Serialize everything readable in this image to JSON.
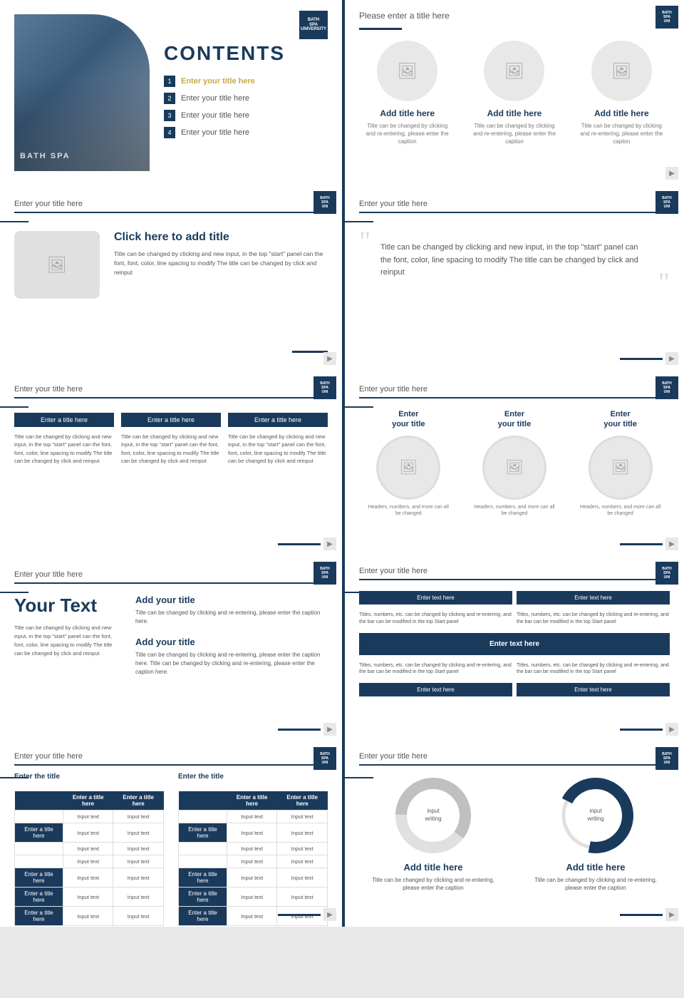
{
  "slides": {
    "slide1": {
      "title": "CONTENTS",
      "logo": "BATH\nSPA\nUNIVERSITY",
      "items": [
        {
          "num": "1",
          "text": "Enter your title here",
          "active": true
        },
        {
          "num": "2",
          "text": "Enter your title here",
          "active": false
        },
        {
          "num": "3",
          "text": "Enter your title here",
          "active": false
        },
        {
          "num": "4",
          "text": "Enter your title here",
          "active": false
        }
      ],
      "bath_text": "BATH SPA"
    },
    "slide2": {
      "title": "Please enter a title here",
      "images": [
        {
          "title": "Add title here",
          "desc": "Title can be changed by clicking and re-entering, please enter the caption"
        },
        {
          "title": "Add title here",
          "desc": "Title can be changed by clicking and re-entering, please enter the caption"
        },
        {
          "title": "Add title here",
          "desc": "Title can be changed by clicking and re-entering, please enter the capton"
        }
      ]
    },
    "slide3": {
      "header": "Enter your title here",
      "click_title": "Click here to add title",
      "body": "Title can be changed by clicking and new input, in the top \"start\" panel can the font, font, color, line spacing to modify The title can be changed by click and reinput"
    },
    "slide4": {
      "header": "Enter your title here",
      "quote": "Title can be changed by clicking and new input, in the top \"start\" panel can the font, color, line spacing to modify The title can be changed by click and reinput"
    },
    "slide5": {
      "header": "Enter your title here",
      "cols": [
        {
          "header": "Enter a title here",
          "text": "Title can be changed by clicking and new input, in the top \"start\" panel can the font, font, color, line spacing to modify The title can be changed by click and reinput"
        },
        {
          "header": "Enter a title here",
          "text": "Title can be changed by clicking and new input, in the top \"start\" panel can the font, font, color, line spacing to modify The title can be changed by click and reinput"
        },
        {
          "header": "Enter a title here",
          "text": "Title can be changed by clicking and new input, in the top \"start\" panel can the font, font, color, line spacing to modify The title can be changed by click and reinput"
        }
      ]
    },
    "slide6": {
      "header": "Enter your title here",
      "circles": [
        {
          "title": "Enter\nyour title",
          "caption": "Headers, numbers, and more can all be changed"
        },
        {
          "title": "Enter\nyour title",
          "caption": "Headers, numbers, and more can all be changed"
        },
        {
          "title": "Enter\nyour title",
          "caption": "Headers, numbers, and more can all be changed"
        }
      ]
    },
    "slide7": {
      "header": "Enter your title here",
      "big_text": "Your Text",
      "body": "Title can be changed by clicking and new input, in the top \"start\" panel can the font, font, color, line spacing to modify The title can be changed by click and reinput",
      "sections": [
        {
          "title": "Add your title",
          "text": "Title can be changed by clicking and re-entering, please enter the caption here."
        },
        {
          "title": "Add your title",
          "text": "Title can be changed by clicking and re-entering, please enter the caption here. Title can be changed by clicking and re-entering, please enter the caption here."
        }
      ]
    },
    "slide8": {
      "header": "Enter your title here",
      "buttons": [
        "Enter text here",
        "Enter text here",
        "Enter text here",
        "Enter text here"
      ],
      "center_btn": "Enter text here",
      "texts": [
        "Titles, numbers, etc. can be changed by clicking and re-entering, and the bar can be modified in the top Start panel",
        "Titles, numbers, etc. can be changed by clicking and re-entering, and the bar can be modified in the top Start panel",
        "Titles, numbers, etc. can be changed by clicking and re-entering, and the bar can be modified in the top Start panel",
        "Titles, numbers, etc. can be changed by clicking and re-entering, and the bar can be modified in the top Start panel"
      ]
    },
    "slide9": {
      "header": "Enter your title here",
      "table1": {
        "title": "Enter the title",
        "headers": [
          "Enter a title here",
          "Enter a title here"
        ],
        "rows": [
          {
            "label": "",
            "cells": [
              "Input text",
              "Input text"
            ]
          },
          {
            "label": "Enter a title here",
            "cells": [
              "Input text",
              "Input text"
            ]
          },
          {
            "label": "",
            "cells": [
              "Input text",
              "Input text"
            ]
          },
          {
            "label": "",
            "cells": [
              "Input text",
              "Input text"
            ]
          },
          {
            "label": "Enter a title here",
            "cells": [
              "Input text",
              "Input text"
            ]
          },
          {
            "label": "Enter a title here",
            "cells": [
              "Input text",
              "Input text"
            ]
          },
          {
            "label": "Enter a title here",
            "cells": [
              "Input text",
              "Input text"
            ]
          }
        ]
      },
      "table2": {
        "title": "Enter the title",
        "headers": [
          "Enter a title here",
          "Enter a title here"
        ],
        "rows": [
          {
            "label": "",
            "cells": [
              "Input text",
              "Input text"
            ]
          },
          {
            "label": "Enter a title here",
            "cells": [
              "Input text",
              "Input text"
            ]
          },
          {
            "label": "",
            "cells": [
              "Input text",
              "Input text"
            ]
          },
          {
            "label": "",
            "cells": [
              "Input text",
              "Input text"
            ]
          },
          {
            "label": "Enter a title here",
            "cells": [
              "Input text",
              "Input text"
            ]
          },
          {
            "label": "Enter a title here",
            "cells": [
              "Input text",
              "Input text"
            ]
          },
          {
            "label": "Enter a title here",
            "cells": [
              "Input text",
              "Input text"
            ]
          }
        ]
      }
    },
    "slide10": {
      "header": "Enter your title here",
      "pies": [
        {
          "center_text": "input writing",
          "title": "Add title here",
          "desc": "Title can be changed by clicking and re-entering, please enter the caption"
        },
        {
          "center_text": "input writing",
          "title": "Add title here",
          "desc": "Title can be changed by clicking and re-entering, please enter the caption"
        }
      ]
    }
  },
  "icons": {
    "image_placeholder": "🖼",
    "arrow_right": "▶"
  },
  "colors": {
    "navy": "#1a3a5c",
    "gold": "#c8a84b",
    "light_gray": "#e8e8e8",
    "medium_gray": "#aaaaaa",
    "text_gray": "#555555"
  }
}
